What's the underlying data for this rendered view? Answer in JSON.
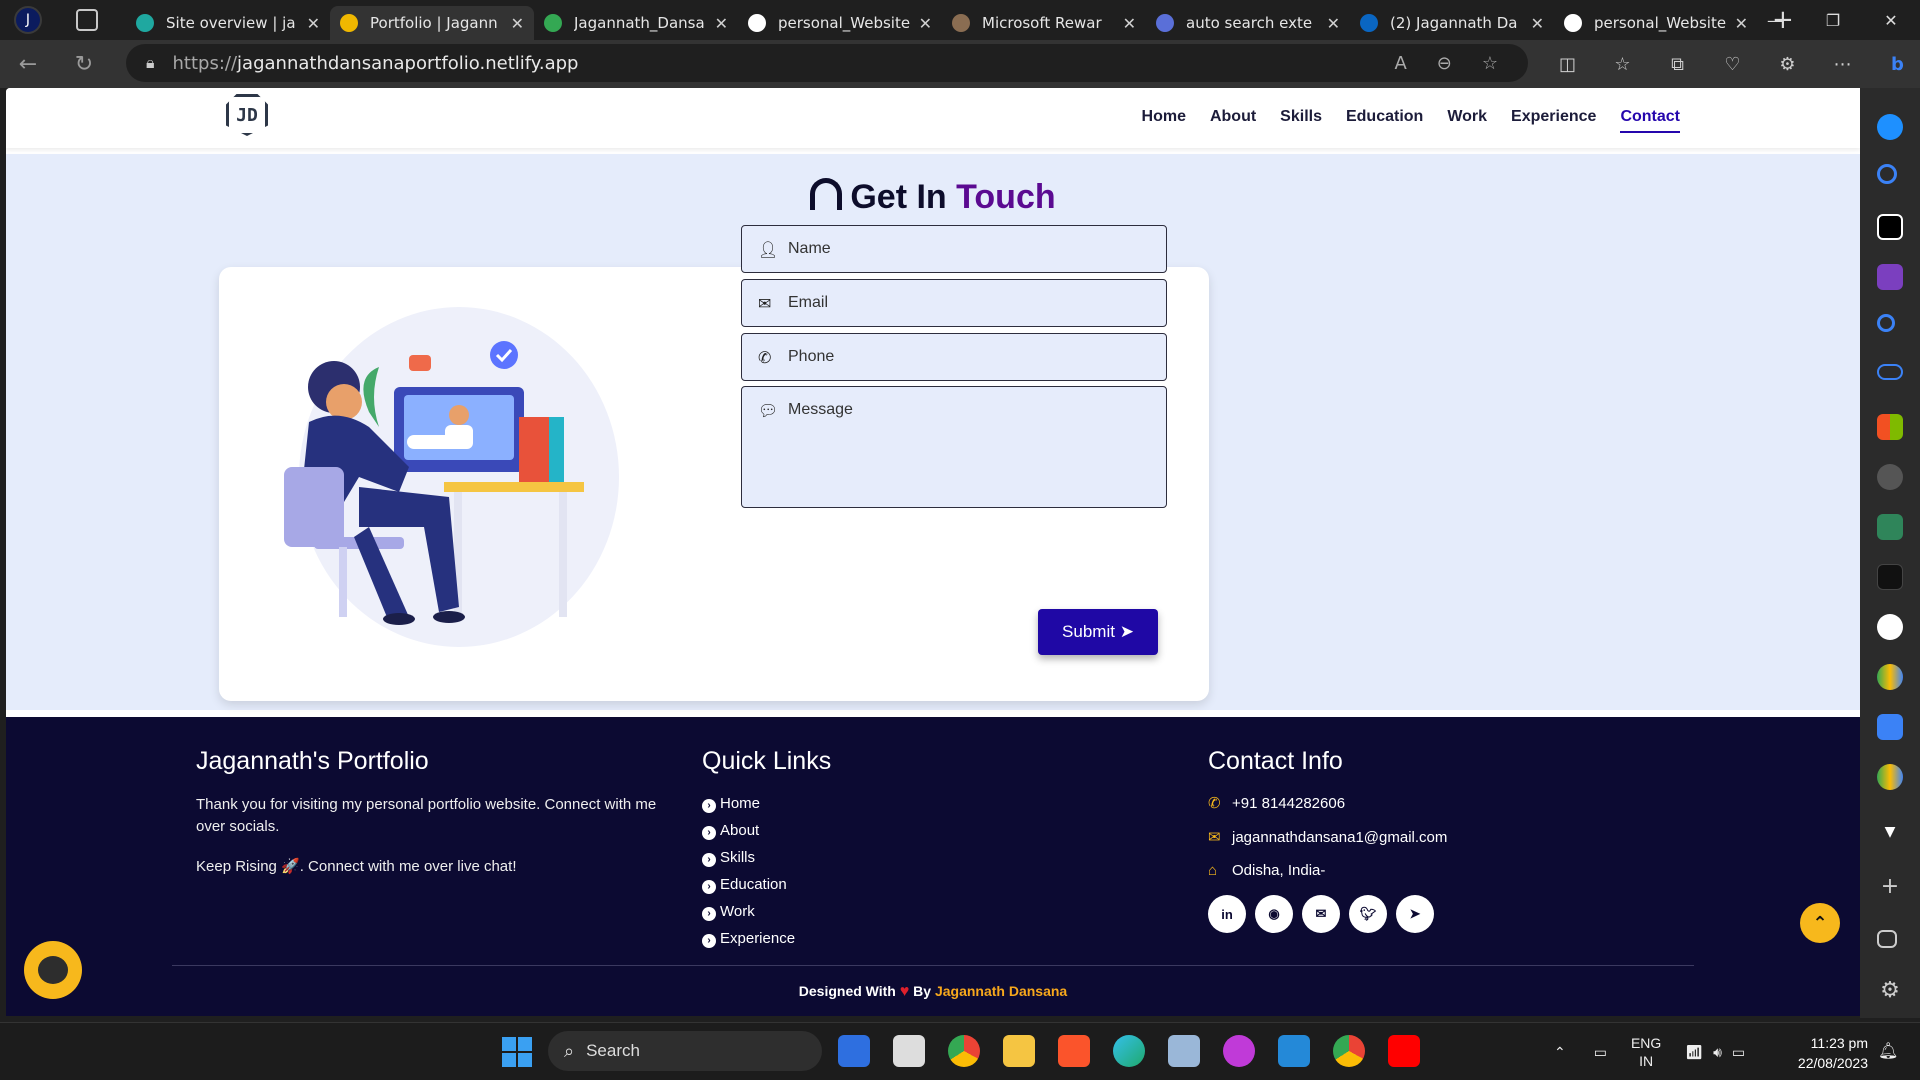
{
  "browser": {
    "profile_initial": "J",
    "tabs": [
      {
        "title": "Site overview | ja",
        "color": "#1fa8a0",
        "active": false
      },
      {
        "title": "Portfolio | Jagann",
        "color": "#f0b800",
        "active": true
      },
      {
        "title": "Jagannath_Dansa",
        "color": "#34a853",
        "active": false
      },
      {
        "title": "personal_Website",
        "color": "#ffffff",
        "active": false
      },
      {
        "title": "Microsoft Rewar",
        "color": "#8a6d52",
        "active": false
      },
      {
        "title": "auto search exte",
        "color": "#5a6fd8",
        "active": false
      },
      {
        "title": "(2) Jagannath Da",
        "color": "#0a66c2",
        "active": false
      },
      {
        "title": "personal_Website",
        "color": "#ffffff",
        "active": false
      }
    ],
    "url_protocol": "https://",
    "url_host": "jagannathdansanaportfolio.netlify.app"
  },
  "site": {
    "logo": "JD",
    "nav": [
      "Home",
      "About",
      "Skills",
      "Education",
      "Work",
      "Experience",
      "Contact"
    ],
    "active_nav": "Contact",
    "heading_part1": "Get In",
    "heading_part2": "Touch",
    "form": {
      "name_placeholder": "Name",
      "email_placeholder": "Email",
      "phone_placeholder": "Phone",
      "message_placeholder": "Message",
      "submit_label": "Submit"
    },
    "footer": {
      "about_title": "Jagannath's Portfolio",
      "about_text": "Thank you for visiting my personal portfolio website. Connect with me over socials.",
      "about_text2": "Keep Rising 🚀. Connect with me over live chat!",
      "links_title": "Quick Links",
      "links": [
        "Home",
        "About",
        "Skills",
        "Education",
        "Work",
        "Experience"
      ],
      "contact_title": "Contact Info",
      "phone": "+91 8144282606",
      "email": "jagannathdansana1@gmail.com",
      "location": "Odisha, India-",
      "credit_prefix": "Designed With",
      "credit_by": "By",
      "credit_name": "Jagannath Dansana"
    }
  },
  "taskbar": {
    "search_label": "Search",
    "lang1": "ENG",
    "lang2": "IN",
    "time": "11:23 pm",
    "date": "22/08/2023"
  },
  "colors": {
    "accent": "#2506ad",
    "heading_accent": "#5b0a91",
    "footer_bg": "#0c0a32",
    "yellow": "#f7b81c"
  }
}
